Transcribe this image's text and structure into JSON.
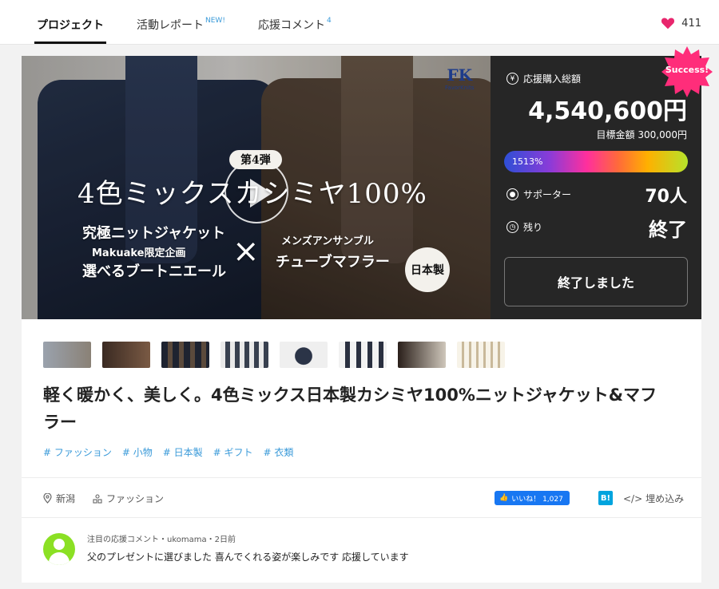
{
  "tabs": {
    "project": "プロジェクト",
    "report": "活動レポート",
    "report_badge": "NEW!",
    "comments": "応援コメント",
    "comments_count": "4"
  },
  "favorites": {
    "count": "411",
    "icon": "heart-icon",
    "color": "#e8266d"
  },
  "hero": {
    "logo_mark": "FK",
    "logo_text": "FavorKnits",
    "badge": "第4弾",
    "title": "4色ミックスカシミヤ100%",
    "left_line1": "究極ニットジャケット",
    "left_line2": "Makuake限定企画",
    "left_line3": "選べるブートニエール",
    "cross": "×",
    "right_line1": "メンズアンサンブル",
    "right_line2": "チューブマフラー",
    "made_in": "日本製"
  },
  "panel": {
    "success_badge": "Success!",
    "total_label": "応援購入総額",
    "total_value": "4,540,600円",
    "goal": "目標金額 300,000円",
    "progress_text": "1513%",
    "progress_percent": 1513,
    "supporters_label": "サポーター",
    "supporters_value": "70人",
    "remaining_label": "残り",
    "remaining_value": "終了",
    "button": "終了しました"
  },
  "thumbnails": 8,
  "title": "軽く暖かく、美しく。4色ミックス日本製カシミヤ100%ニットジャケット&マフラー",
  "tags": [
    "# ファッション",
    "# 小物",
    "# 日本製",
    "# ギフト",
    "# 衣類"
  ],
  "meta": {
    "location": "新潟",
    "category": "ファッション"
  },
  "share": {
    "like": "いいね！ 1,027",
    "hatena": "B!",
    "embed": "埋め込み"
  },
  "comment": {
    "meta": "注目の応援コメント・ukomama・2日前",
    "text": "父のプレゼントに選びました 喜んでくれる姿が楽しみです 応援しています"
  }
}
